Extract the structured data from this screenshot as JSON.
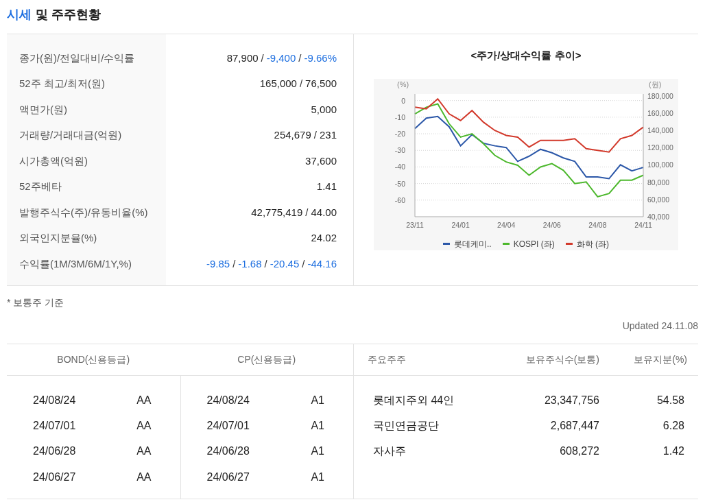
{
  "title": {
    "accent": "시세",
    "rest": "및 주주현황"
  },
  "summary": {
    "rows": [
      {
        "label": "종가(원)/전일대비/수익률",
        "separator": "/",
        "values": [
          {
            "text": "87,900",
            "negative": false
          },
          {
            "text": "-9,400",
            "negative": true
          },
          {
            "text": "-9.66%",
            "negative": true
          }
        ]
      },
      {
        "label": "52주 최고/최저(원)",
        "separator": "/",
        "values": [
          {
            "text": "165,000",
            "negative": false
          },
          {
            "text": "76,500",
            "negative": false
          }
        ]
      },
      {
        "label": "액면가(원)",
        "values": [
          {
            "text": "5,000",
            "negative": false
          }
        ]
      },
      {
        "label": "거래량/거래대금(억원)",
        "separator": "/",
        "values": [
          {
            "text": "254,679",
            "negative": false
          },
          {
            "text": "231",
            "negative": false
          }
        ]
      },
      {
        "label": "시가총액(억원)",
        "values": [
          {
            "text": "37,600",
            "negative": false
          }
        ]
      },
      {
        "label": "52주베타",
        "values": [
          {
            "text": "1.41",
            "negative": false
          }
        ]
      },
      {
        "label": "발행주식수(주)/유동비율(%)",
        "separator": "/",
        "values": [
          {
            "text": "42,775,419",
            "negative": false
          },
          {
            "text": "44.00",
            "negative": false
          }
        ]
      },
      {
        "label": "외국인지분율(%)",
        "values": [
          {
            "text": "24.02",
            "negative": false
          }
        ]
      },
      {
        "label": "수익률(1M/3M/6M/1Y,%)",
        "separator": "/",
        "values": [
          {
            "text": "-9.85",
            "negative": true
          },
          {
            "text": "-1.68",
            "negative": true
          },
          {
            "text": "-20.45",
            "negative": true
          },
          {
            "text": "-44.16",
            "negative": true
          }
        ]
      }
    ]
  },
  "chart": {
    "chart_data": {
      "type": "line",
      "title": "<주가/상대수익률 추이>",
      "ylabel": "(%)",
      "y2label": "(원)",
      "categories": [
        "23/11",
        null,
        null,
        null,
        "24/01",
        null,
        null,
        null,
        "24/04",
        null,
        null,
        null,
        "24/06",
        null,
        null,
        null,
        "24/08",
        null,
        null,
        null,
        "24/11"
      ],
      "grid": true,
      "legend": "bottom",
      "ylim": [
        -70,
        4
      ],
      "yticks": [
        0,
        -10,
        -20,
        -30,
        -40,
        -50,
        -60
      ],
      "y2lim": [
        40000,
        182000
      ],
      "y2ticks": [
        {
          "value": 180000,
          "label": "180,000"
        },
        {
          "value": 160000,
          "label": "160,000"
        },
        {
          "value": 140000,
          "label": "140,000"
        },
        {
          "value": 120000,
          "label": "120,000"
        },
        {
          "value": 100000,
          "label": "100,000"
        },
        {
          "value": 80000,
          "label": "80,000"
        },
        {
          "value": 60000,
          "label": "60,000"
        },
        {
          "value": 40000,
          "label": "40,000"
        }
      ],
      "series": [
        {
          "name": "롯데케미..",
          "color": "#2b57a8",
          "axis": "y2",
          "values": [
            142000,
            154000,
            156000,
            144000,
            122000,
            135000,
            125000,
            122000,
            120000,
            104000,
            110000,
            118000,
            114000,
            108000,
            104000,
            86000,
            86000,
            84000,
            100000,
            93000,
            97000
          ]
        },
        {
          "name": "KOSPI (좌)",
          "color": "#4cb82c",
          "values": [
            -8,
            -4,
            -2,
            -14,
            -22,
            -20,
            -26,
            -33,
            -37,
            -39,
            -45,
            -40,
            -38,
            -42,
            -50,
            -49,
            -58,
            -56,
            -48,
            -48,
            -45
          ]
        },
        {
          "name": "화학 (좌)",
          "color": "#d2392b",
          "values": [
            -4,
            -5,
            1,
            -8,
            -12,
            -6,
            -13,
            -18,
            -21,
            -22,
            -28,
            -24,
            -24,
            -24,
            -23,
            -29,
            -30,
            -31,
            -23,
            -21,
            -16
          ]
        }
      ]
    }
  },
  "note": "* 보통주 기준",
  "updated": "Updated 24.11.08",
  "ratings": {
    "groups": [
      {
        "title": "BOND(신용등급)",
        "rows": [
          {
            "date": "24/08/24",
            "grade": "AA"
          },
          {
            "date": "24/07/01",
            "grade": "AA"
          },
          {
            "date": "24/06/28",
            "grade": "AA"
          },
          {
            "date": "24/06/27",
            "grade": "AA"
          }
        ]
      },
      {
        "title": "CP(신용등급)",
        "rows": [
          {
            "date": "24/08/24",
            "grade": "A1"
          },
          {
            "date": "24/07/01",
            "grade": "A1"
          },
          {
            "date": "24/06/28",
            "grade": "A1"
          },
          {
            "date": "24/06/27",
            "grade": "A1"
          }
        ]
      }
    ]
  },
  "holders": {
    "columns": [
      "주요주주",
      "보유주식수(보통)",
      "보유지분(%)"
    ],
    "rows": [
      {
        "name": "롯데지주외 44인",
        "shares": "23,347,756",
        "stake": "54.58"
      },
      {
        "name": "국민연금공단",
        "shares": "2,687,447",
        "stake": "6.28"
      },
      {
        "name": "자사주",
        "shares": "608,272",
        "stake": "1.42"
      }
    ]
  }
}
